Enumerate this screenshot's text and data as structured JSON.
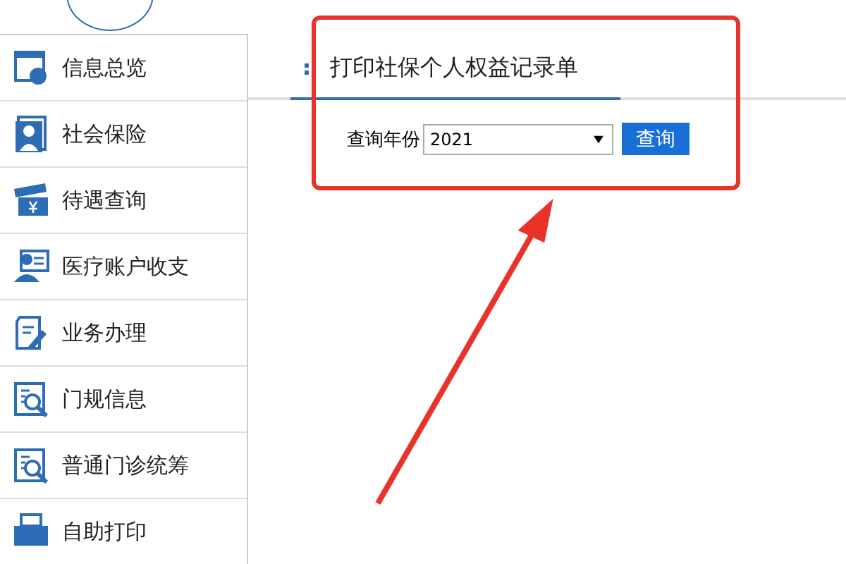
{
  "sidebar": {
    "items": [
      {
        "label": "信息总览"
      },
      {
        "label": "社会保险"
      },
      {
        "label": "待遇查询"
      },
      {
        "label": "医疗账户收支"
      },
      {
        "label": "业务办理"
      },
      {
        "label": "门规信息"
      },
      {
        "label": "普通门诊统筹"
      },
      {
        "label": "自助打印"
      }
    ]
  },
  "tab": {
    "title": "打印社保个人权益记录单"
  },
  "form": {
    "label": "查询年份",
    "year": {
      "value": "2021"
    },
    "button": "查询"
  }
}
